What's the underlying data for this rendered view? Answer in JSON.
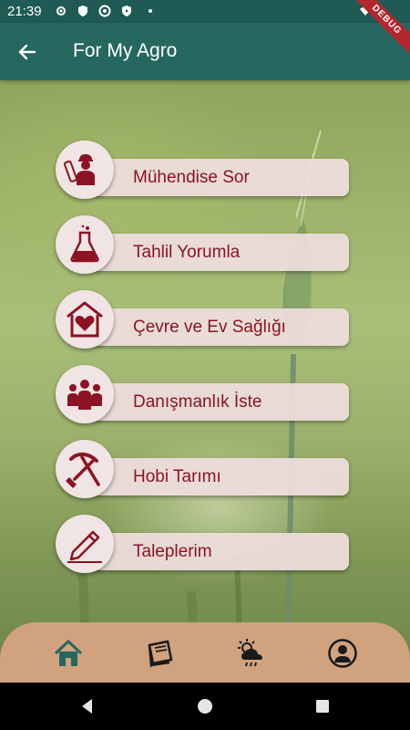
{
  "status_bar": {
    "time": "21:39",
    "debug_label": "DEBUG"
  },
  "app_bar": {
    "title": "For My Agro",
    "back_icon": "arrow-left-icon"
  },
  "menu": {
    "items": [
      {
        "label": "Mühendise Sor",
        "icon": "engineer-icon"
      },
      {
        "label": "Tahlil Yorumla",
        "icon": "flask-icon"
      },
      {
        "label": "Çevre ve Ev Sağlığı",
        "icon": "house-heart-icon"
      },
      {
        "label": "Danışmanlık İste",
        "icon": "group-icon"
      },
      {
        "label": "Hobi Tarımı",
        "icon": "pickaxe-shovel-icon"
      },
      {
        "label": "Taleplerim",
        "icon": "pencil-icon"
      }
    ]
  },
  "bottom_nav": {
    "items": [
      {
        "icon": "home-icon",
        "active": true
      },
      {
        "icon": "book-icon",
        "active": false
      },
      {
        "icon": "weather-icon",
        "active": false
      },
      {
        "icon": "profile-icon",
        "active": false
      }
    ]
  },
  "colors": {
    "primary": "#26675f",
    "accent": "#8c1323",
    "card": "#eedede",
    "bottom_nav": "#d0a27e"
  }
}
